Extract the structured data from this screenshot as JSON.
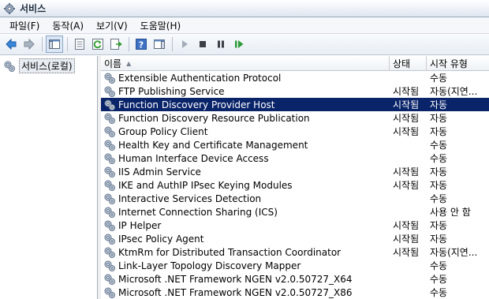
{
  "window": {
    "title": "서비스"
  },
  "menu": [
    "파일(F)",
    "동작(A)",
    "보기(V)",
    "도움말(H)"
  ],
  "tree": {
    "root_label": "서비스(로컬)"
  },
  "columns": {
    "name": "이름",
    "status": "상태",
    "startup": "시작 유형"
  },
  "services": [
    {
      "name": "Extensible Authentication Protocol",
      "status": "",
      "startup": "수동"
    },
    {
      "name": "FTP Publishing Service",
      "status": "시작됨",
      "startup": "자동(지연..."
    },
    {
      "name": "Function Discovery Provider Host",
      "status": "시작됨",
      "startup": "자동",
      "selected": true
    },
    {
      "name": "Function Discovery Resource Publication",
      "status": "시작됨",
      "startup": "자동"
    },
    {
      "name": "Group Policy Client",
      "status": "시작됨",
      "startup": "자동"
    },
    {
      "name": "Health Key and Certificate Management",
      "status": "",
      "startup": "수동"
    },
    {
      "name": "Human Interface Device Access",
      "status": "",
      "startup": "수동"
    },
    {
      "name": "IIS Admin Service",
      "status": "시작됨",
      "startup": "자동"
    },
    {
      "name": "IKE and AuthIP IPsec Keying Modules",
      "status": "시작됨",
      "startup": "자동"
    },
    {
      "name": "Interactive Services Detection",
      "status": "",
      "startup": "수동"
    },
    {
      "name": "Internet Connection Sharing (ICS)",
      "status": "",
      "startup": "사용 안 함"
    },
    {
      "name": "IP Helper",
      "status": "시작됨",
      "startup": "자동"
    },
    {
      "name": "IPsec Policy Agent",
      "status": "시작됨",
      "startup": "자동"
    },
    {
      "name": "KtmRm for Distributed Transaction Coordinator",
      "status": "시작됨",
      "startup": "자동(지연..."
    },
    {
      "name": "Link-Layer Topology Discovery Mapper",
      "status": "",
      "startup": "수동"
    },
    {
      "name": "Microsoft .NET Framework NGEN v2.0.50727_X64",
      "status": "",
      "startup": "수동"
    },
    {
      "name": "Microsoft .NET Framework NGEN v2.0.50727_X86",
      "status": "",
      "startup": "수동"
    }
  ],
  "colors": {
    "selection": "#0a246a",
    "accent": "#2a6fc9"
  }
}
